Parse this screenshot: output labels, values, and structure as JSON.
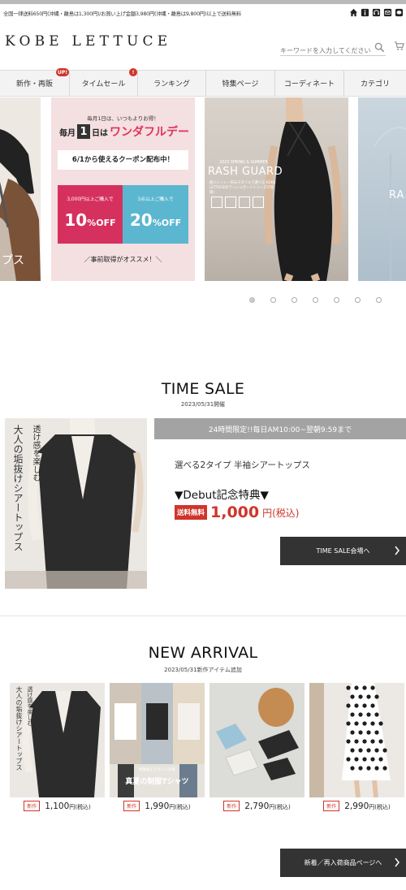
{
  "notice": "全国一律送料650円(沖縄・離島は1,300円)/お買い上げ金額3,980円(沖縄・離島は9,800円)以上で送料無料",
  "utility_icons": [
    "home-icon",
    "info-icon",
    "headset-icon",
    "mail-icon",
    "line-icon"
  ],
  "logo": "KOBE LETTUCE",
  "search": {
    "placeholder": "キーワードを入力してください"
  },
  "nav": [
    {
      "label": "新作・再販",
      "badge": "UP!"
    },
    {
      "label": "タイムセール",
      "badge": "!"
    },
    {
      "label": "ランキング"
    },
    {
      "label": "特集ページ"
    },
    {
      "label": "コーディネート"
    },
    {
      "label": "カテゴリ"
    }
  ],
  "slides": {
    "s1_text": "プス",
    "s2": {
      "top": "毎月1日は、いつもよりお得！",
      "headline": "毎月",
      "day": "1",
      "headline2": "日は",
      "headline3": "ワンダフルデー",
      "sub": "6/1から使えるクーポン配布中！",
      "c1_cond": "3,000円以上ご購入で",
      "c1_val": "10",
      "c2_cond": "3点以上ご購入で",
      "c2_val": "20",
      "off": "%OFF",
      "note": "／事前取得がオススメ！＼"
    },
    "s3": {
      "small": "2023 SPRING & SUMMER",
      "title": "RASH GUARD",
      "desc": "使いシーン・好みスタイルで選べる KOBE LETTUCEのラッシュガードシリーズが登場！"
    },
    "s4_text": "RA"
  },
  "slider_dots": {
    "count": 7,
    "active": 0
  },
  "time_sale": {
    "title": "TIME SALE",
    "date": "2023/05/31開催",
    "bar": "24時間限定!!毎日AM10:00~翌朝9:59まで",
    "product": "選べる2タイプ 半袖シアートップス",
    "debut": "▼Debut記念特典▼",
    "free_shipping": "送料無料",
    "price": "1,000",
    "price_suffix": "円(税込)",
    "img_copy1": "透け感を楽しむ",
    "img_copy2": "大人の垢抜けシアートップス",
    "button": "TIME SALE会場へ"
  },
  "new_arrival": {
    "title": "NEW ARRIVAL",
    "date": "2023/05/31新作アイテム追加",
    "new_label": "新作",
    "yen": "円",
    "tax": "(税込)",
    "items": [
      {
        "price": "1,100",
        "copy1": "透け感を楽しむ",
        "copy2": "大人の垢抜けシアートップス"
      },
      {
        "price": "1,990",
        "copy1": "真夏の制服Tシャツ",
        "copy2": "特殊加工で汗ジミ対策"
      },
      {
        "price": "2,790"
      },
      {
        "price": "2,990"
      }
    ],
    "button": "新着／再入荷商品ページへ"
  },
  "colors": {
    "accent_red": "#d0342a",
    "dark": "#333333",
    "bar_gray": "#a3a3a3"
  }
}
